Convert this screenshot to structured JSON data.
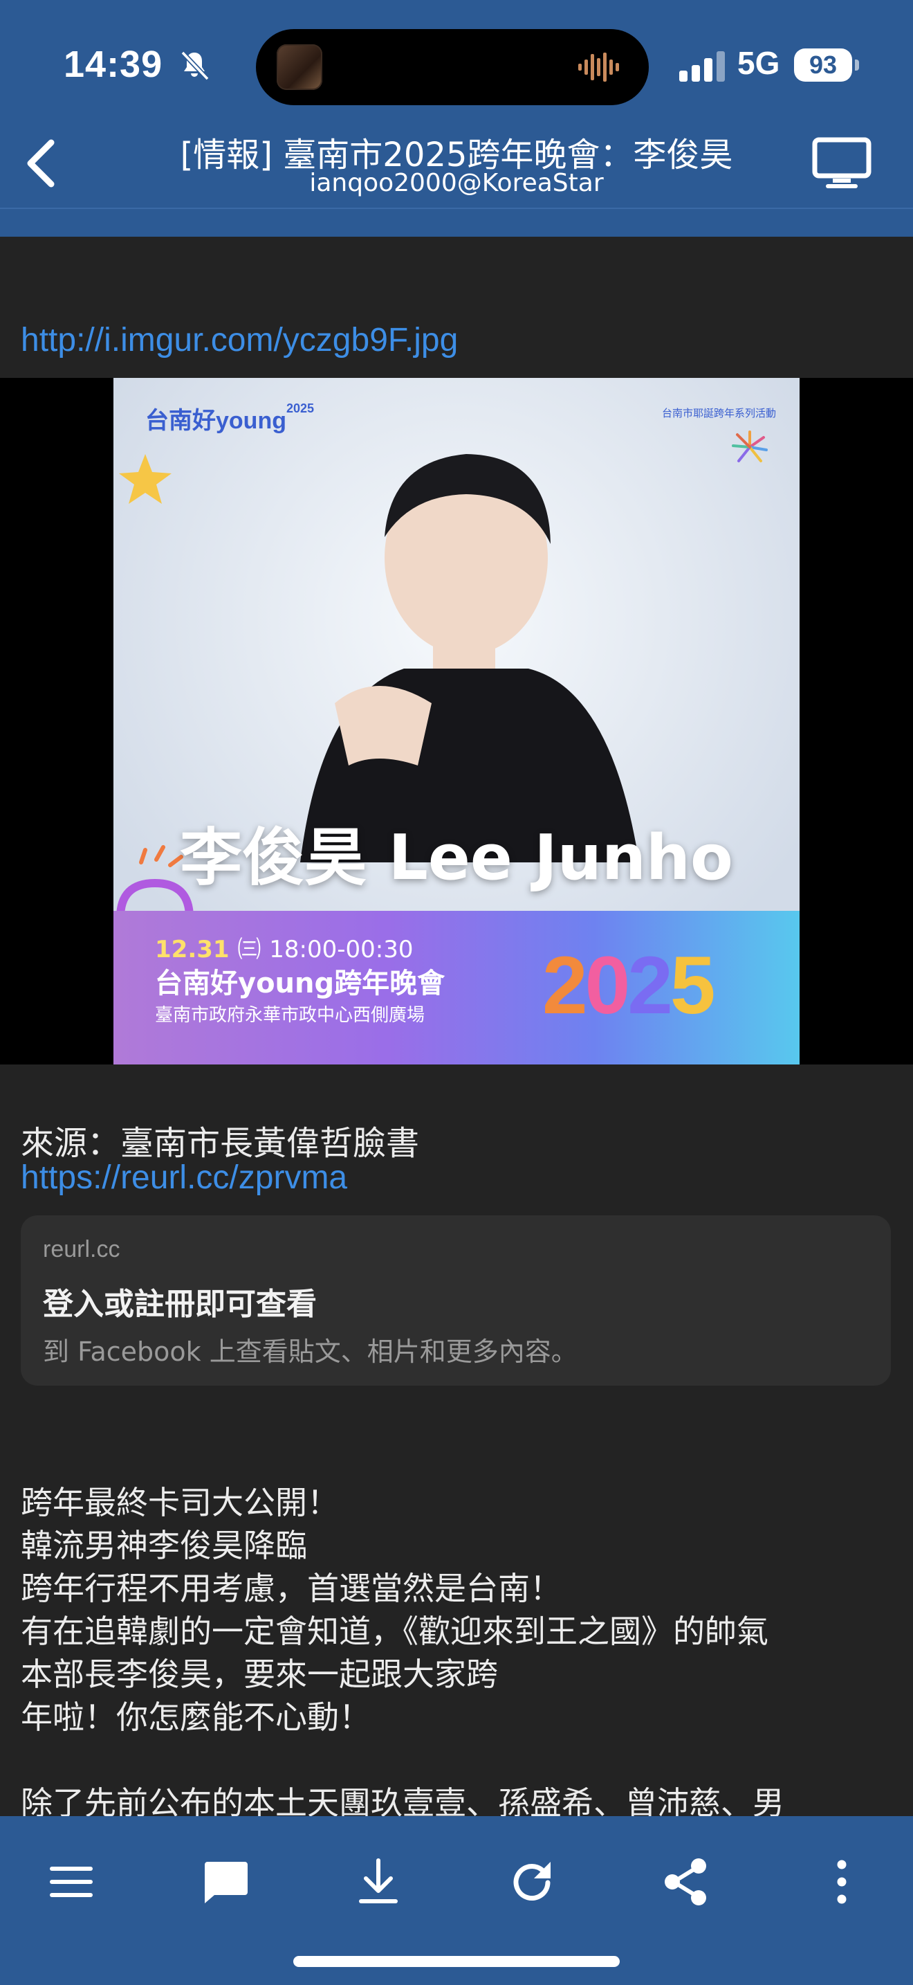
{
  "status_bar": {
    "time": "14:39",
    "network": "5G",
    "battery": "93",
    "icons": [
      "bell-slash-icon",
      "dynamic-island-media-thumbnail",
      "audio-waveform-icon",
      "signal-bars-icon",
      "battery-icon"
    ]
  },
  "header": {
    "title": "[情報] 臺南市2025跨年晚會：李俊昊",
    "subtitle": "ianqoo2000@KoreaStar",
    "back_icon": "chevron-left-icon",
    "right_icon": "monitor-icon"
  },
  "article": {
    "image_link": "http://i.imgur.com/yczgb9F.jpg",
    "poster": {
      "logo": "台南好young",
      "logo_year": "2025",
      "event_tag": "台南市耶誕跨年系列活動",
      "headline": "李俊昊 Lee Junho",
      "date": "12.31",
      "weekday": "㈢",
      "time": "18:00-00:30",
      "show_name": "台南好young跨年晚會",
      "venue": "臺南市政府永華市政中心西側廣場",
      "year_digits": [
        "2",
        "0",
        "2",
        "5"
      ]
    },
    "source_label": "來源：臺南市長黃偉哲臉書",
    "source_link": "https://reurl.cc/zprvma",
    "link_card": {
      "domain": "reurl.cc",
      "title": "登入或註冊即可查看",
      "description": "到 Facebook 上查看貼文、相片和更多內容。"
    },
    "body_lines": [
      "跨年最終卡司大公開！",
      "韓流男神李俊昊降臨",
      "跨年行程不用考慮，首選當然是台南！",
      "有在追韓劇的一定會知道，《歡迎來到王之國》的帥氣",
      "本部長李俊昊，要來一起跟大家跨",
      "年啦！你怎麼能不心動！",
      "",
      "除了先前公布的本土天團玖壹壹、孫盛希、曾沛慈、男"
    ]
  },
  "toolbar": {
    "buttons": [
      "menu-icon",
      "comment-icon",
      "download-icon",
      "refresh-icon",
      "share-icon",
      "more-vertical-icon"
    ]
  },
  "colors": {
    "bar_blue": "#2c5a94",
    "background": "#232323",
    "link": "#3d8ee6",
    "card": "#2f2f2f"
  }
}
